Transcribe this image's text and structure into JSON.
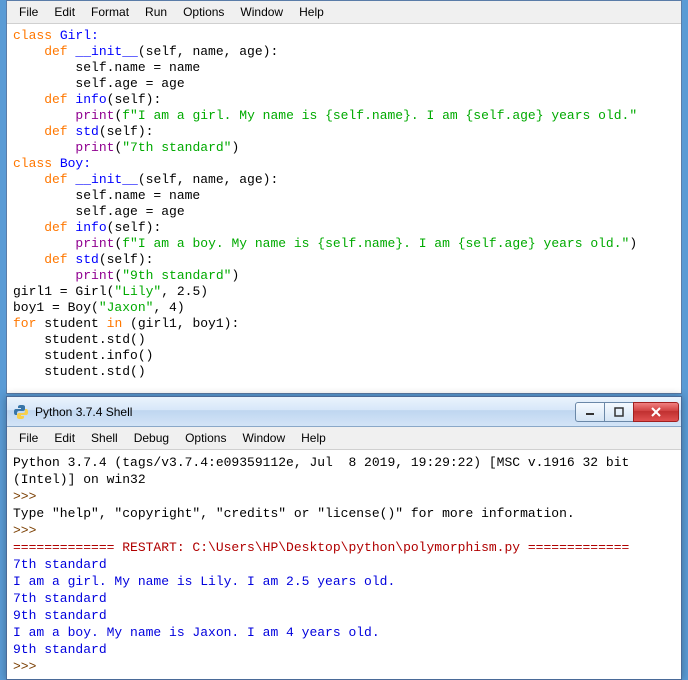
{
  "editor": {
    "menu": [
      "File",
      "Edit",
      "Format",
      "Run",
      "Options",
      "Window",
      "Help"
    ],
    "lines": [
      [
        {
          "t": "class ",
          "c": "kw-orange"
        },
        {
          "t": "Girl:",
          "c": "kw-blue"
        }
      ],
      [
        {
          "t": "    def ",
          "c": "kw-orange"
        },
        {
          "t": "__init__",
          "c": "kw-blue"
        },
        {
          "t": "(self, name, age):",
          "c": "plain"
        }
      ],
      [
        {
          "t": "        self.name = name",
          "c": "plain"
        }
      ],
      [
        {
          "t": "        self.age = age",
          "c": "plain"
        }
      ],
      [
        {
          "t": "    def ",
          "c": "kw-orange"
        },
        {
          "t": "info",
          "c": "kw-blue"
        },
        {
          "t": "(self):",
          "c": "plain"
        }
      ],
      [
        {
          "t": "        ",
          "c": "plain"
        },
        {
          "t": "print",
          "c": "kw-purple"
        },
        {
          "t": "(",
          "c": "plain"
        },
        {
          "t": "f\"I am a girl. My name is {self.name}. I am {self.age} years old.\"",
          "c": "str-green"
        }
      ],
      [
        {
          "t": "    def ",
          "c": "kw-orange"
        },
        {
          "t": "std",
          "c": "kw-blue"
        },
        {
          "t": "(self):",
          "c": "plain"
        }
      ],
      [
        {
          "t": "        ",
          "c": "plain"
        },
        {
          "t": "print",
          "c": "kw-purple"
        },
        {
          "t": "(",
          "c": "plain"
        },
        {
          "t": "\"7th standard\"",
          "c": "str-green"
        },
        {
          "t": ")",
          "c": "plain"
        }
      ],
      [
        {
          "t": "class ",
          "c": "kw-orange"
        },
        {
          "t": "Boy:",
          "c": "kw-blue"
        }
      ],
      [
        {
          "t": "    def ",
          "c": "kw-orange"
        },
        {
          "t": "__init__",
          "c": "kw-blue"
        },
        {
          "t": "(self, name, age):",
          "c": "plain"
        }
      ],
      [
        {
          "t": "        self.name = name",
          "c": "plain"
        }
      ],
      [
        {
          "t": "        self.age = age",
          "c": "plain"
        }
      ],
      [
        {
          "t": "    def ",
          "c": "kw-orange"
        },
        {
          "t": "info",
          "c": "kw-blue"
        },
        {
          "t": "(self):",
          "c": "plain"
        }
      ],
      [
        {
          "t": "        ",
          "c": "plain"
        },
        {
          "t": "print",
          "c": "kw-purple"
        },
        {
          "t": "(",
          "c": "plain"
        },
        {
          "t": "f\"I am a boy. My name is {self.name}. I am {self.age} years old.\"",
          "c": "str-green"
        },
        {
          "t": ")",
          "c": "plain"
        }
      ],
      [
        {
          "t": "    def ",
          "c": "kw-orange"
        },
        {
          "t": "std",
          "c": "kw-blue"
        },
        {
          "t": "(self):",
          "c": "plain"
        }
      ],
      [
        {
          "t": "        ",
          "c": "plain"
        },
        {
          "t": "print",
          "c": "kw-purple"
        },
        {
          "t": "(",
          "c": "plain"
        },
        {
          "t": "\"9th standard\"",
          "c": "str-green"
        },
        {
          "t": ")",
          "c": "plain"
        }
      ],
      [
        {
          "t": "girl1 = Girl(",
          "c": "plain"
        },
        {
          "t": "\"Lily\"",
          "c": "str-green"
        },
        {
          "t": ", ",
          "c": "plain"
        },
        {
          "t": "2.5",
          "c": "plain"
        },
        {
          "t": ")",
          "c": "plain"
        }
      ],
      [
        {
          "t": "boy1 = Boy(",
          "c": "plain"
        },
        {
          "t": "\"Jaxon\"",
          "c": "str-green"
        },
        {
          "t": ", ",
          "c": "plain"
        },
        {
          "t": "4",
          "c": "plain"
        },
        {
          "t": ")",
          "c": "plain"
        }
      ],
      [
        {
          "t": "for ",
          "c": "kw-orange"
        },
        {
          "t": "student ",
          "c": "plain"
        },
        {
          "t": "in ",
          "c": "kw-orange"
        },
        {
          "t": "(girl1, boy1):",
          "c": "plain"
        }
      ],
      [
        {
          "t": "    student.std()",
          "c": "plain"
        }
      ],
      [
        {
          "t": "    student.info()",
          "c": "plain"
        }
      ],
      [
        {
          "t": "    student.std()",
          "c": "plain"
        }
      ]
    ]
  },
  "shell": {
    "title": "Python 3.7.4 Shell",
    "menu": [
      "File",
      "Edit",
      "Shell",
      "Debug",
      "Options",
      "Window",
      "Help"
    ],
    "lines": [
      {
        "t": "Python 3.7.4 (tags/v3.7.4:e09359112e, Jul  8 2019, 19:29:22) [MSC v.1916 32 bit (Intel)] on win32",
        "c": "plain"
      },
      {
        "t": ">>> ",
        "c": "prompt"
      },
      {
        "t": "Type \"help\", \"copyright\", \"credits\" or \"license()\" for more information.",
        "c": "plain"
      },
      {
        "t": ">>> ",
        "c": "prompt"
      },
      {
        "t": "============= RESTART: C:\\Users\\HP\\Desktop\\python\\polymorphism.py =============",
        "c": "restart"
      },
      {
        "t": "7th standard",
        "c": "out-blue"
      },
      {
        "t": "I am a girl. My name is Lily. I am 2.5 years old.",
        "c": "out-blue"
      },
      {
        "t": "7th standard",
        "c": "out-blue"
      },
      {
        "t": "9th standard",
        "c": "out-blue"
      },
      {
        "t": "I am a boy. My name is Jaxon. I am 4 years old.",
        "c": "out-blue"
      },
      {
        "t": "9th standard",
        "c": "out-blue"
      },
      {
        "t": ">>> ",
        "c": "prompt"
      }
    ]
  }
}
